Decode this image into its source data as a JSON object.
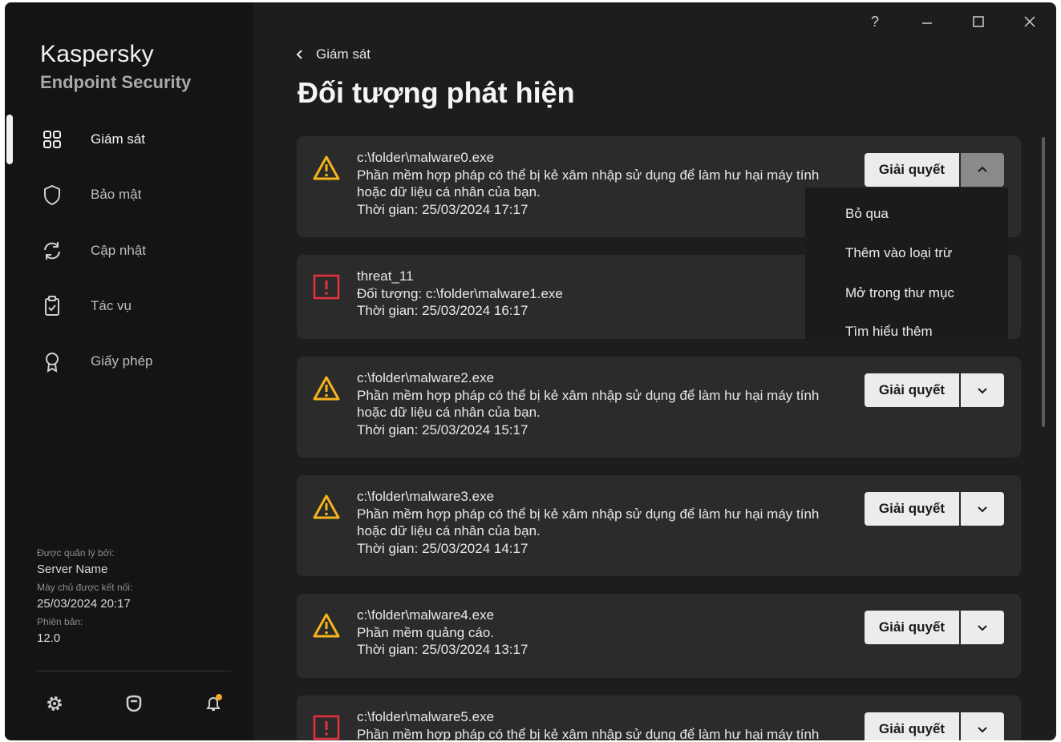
{
  "app": {
    "brand_line1": "Kaspersky",
    "brand_line2": "Endpoint Security"
  },
  "window_controls": {
    "help": "?",
    "minimize_icon": "minimize-icon",
    "maximize_icon": "maximize-icon",
    "close_icon": "close-icon"
  },
  "sidebar": {
    "items": [
      {
        "label": "Giám sát",
        "icon": "dashboard-icon",
        "active": true
      },
      {
        "label": "Bảo mật",
        "icon": "shield-icon"
      },
      {
        "label": "Cập nhật",
        "icon": "refresh-icon"
      },
      {
        "label": "Tác vụ",
        "icon": "clipboard-check-icon"
      },
      {
        "label": "Giấy phép",
        "icon": "license-award-icon"
      }
    ],
    "managed_by_label": "Được quản lý bởi:",
    "managed_by_value": "Server Name",
    "server_connected_label": "Máy chủ được kết nối:",
    "server_connected_value": "25/03/2024 20:17",
    "version_label": "Phiên bản:",
    "version_value": "12.0",
    "bottom_icons": [
      "settings-icon",
      "support-icon",
      "notifications-icon"
    ]
  },
  "breadcrumb": {
    "back_label": "Giám sát"
  },
  "page": {
    "title": "Đối tượng phát hiện"
  },
  "resolve_label": "Giải quyết",
  "detections": [
    {
      "severity": "warning",
      "line1": "c:\\folder\\malware0.exe",
      "line2": "Phần mềm hợp pháp có thể bị kẻ xâm nhập sử dụng để làm hư hại máy tính",
      "line3": "hoặc dữ liệu cá nhân của bạn.",
      "line4": "Thời gian: 25/03/2024 17:17",
      "menu_open": true
    },
    {
      "severity": "critical",
      "line1": "threat_11",
      "line2": "Đối tượng: c:\\folder\\malware1.exe",
      "line3": "Thời gian: 25/03/2024 16:17",
      "line4": ""
    },
    {
      "severity": "warning",
      "line1": "c:\\folder\\malware2.exe",
      "line2": "Phần mềm hợp pháp có thể bị kẻ xâm nhập sử dụng để làm hư hại máy tính",
      "line3": "hoặc dữ liệu cá nhân của bạn.",
      "line4": "Thời gian: 25/03/2024 15:17"
    },
    {
      "severity": "warning",
      "line1": "c:\\folder\\malware3.exe",
      "line2": "Phần mềm hợp pháp có thể bị kẻ xâm nhập sử dụng để làm hư hại máy tính",
      "line3": "hoặc dữ liệu cá nhân của bạn.",
      "line4": "Thời gian: 25/03/2024 14:17"
    },
    {
      "severity": "warning",
      "line1": "c:\\folder\\malware4.exe",
      "line2": "Phần mềm quảng cáo.",
      "line3": "Thời gian: 25/03/2024 13:17",
      "line4": ""
    },
    {
      "severity": "critical",
      "line1": "c:\\folder\\malware5.exe",
      "line2": "Phần mềm hợp pháp có thể bị kẻ xâm nhập sử dụng để làm hư hại máy tính",
      "line3": "",
      "line4": ""
    }
  ],
  "dropdown_menu": {
    "items": [
      "Bỏ qua",
      "Thêm vào loại trừ",
      "Mở trong thư mục",
      "Tìm hiểu thêm"
    ]
  },
  "colors": {
    "warning": "#f5b41c",
    "critical": "#e5323f",
    "notification_dot": "#f5a623",
    "background": "#1d1d1d",
    "sidebar": "#141414",
    "card": "#2b2b2b"
  }
}
